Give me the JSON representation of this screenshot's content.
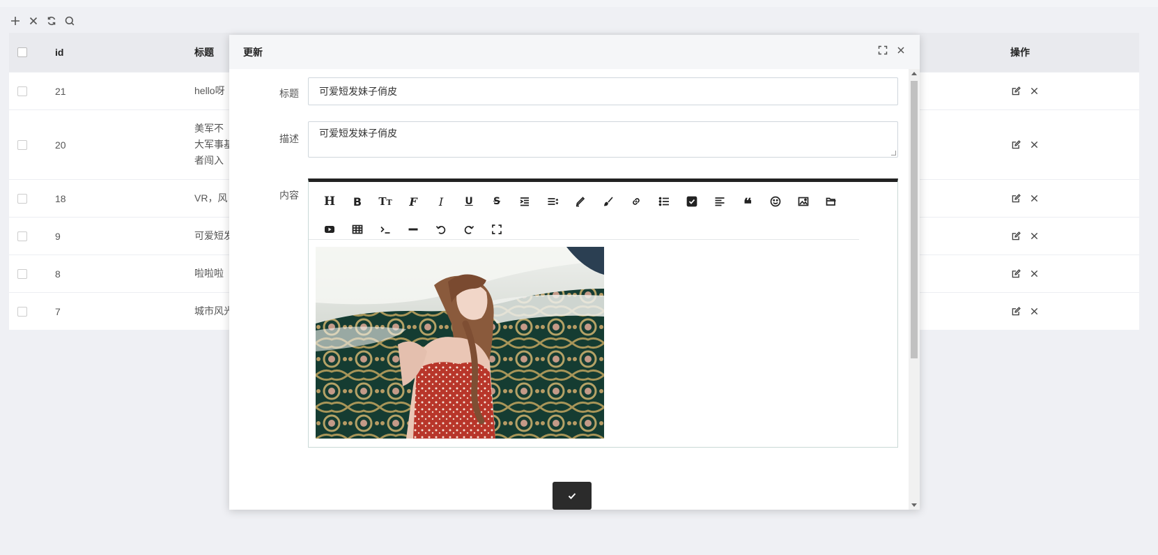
{
  "toolbar": {
    "icons": [
      "plus-icon",
      "close-icon",
      "refresh-icon",
      "search-icon"
    ]
  },
  "table": {
    "headers": {
      "id": "id",
      "title": "标题",
      "ops": "操作"
    },
    "rows": [
      {
        "id": "21",
        "title": [
          "hello呀"
        ]
      },
      {
        "id": "20",
        "title": [
          "美军不",
          "大军事基",
          "者闯入"
        ]
      },
      {
        "id": "18",
        "title": [
          "VR，风"
        ]
      },
      {
        "id": "9",
        "title": [
          "可爱短发"
        ]
      },
      {
        "id": "8",
        "title": [
          "啦啦啦"
        ]
      },
      {
        "id": "7",
        "title": [
          "城市风光"
        ]
      }
    ]
  },
  "modal": {
    "title": "更新",
    "form": {
      "title_label": "标题",
      "title_value": "可爱短发妹子俏皮",
      "desc_label": "描述",
      "desc_value": "可爱短发妹子俏皮",
      "content_label": "内容"
    },
    "editor_toolbar": [
      "header-icon",
      "bold-icon",
      "text-size-icon",
      "font-icon",
      "italic-icon",
      "underline-icon",
      "strikethrough-icon",
      "indent-icon",
      "align-icon",
      "highlight-icon",
      "brush-icon",
      "link-icon",
      "list-icon",
      "checkbox-icon",
      "paragraph-icon",
      "quote-icon",
      "emoji-icon",
      "image-icon",
      "folder-icon",
      "video-icon",
      "table-icon",
      "code-icon",
      "hr-icon",
      "undo-icon",
      "redo-icon",
      "fullscreen-icon"
    ],
    "submit_icon": "check-icon"
  },
  "colors": {
    "page_bg": "#eff0f4",
    "editor_border_top": "#222222",
    "submit_bg": "#2b2b2b"
  }
}
